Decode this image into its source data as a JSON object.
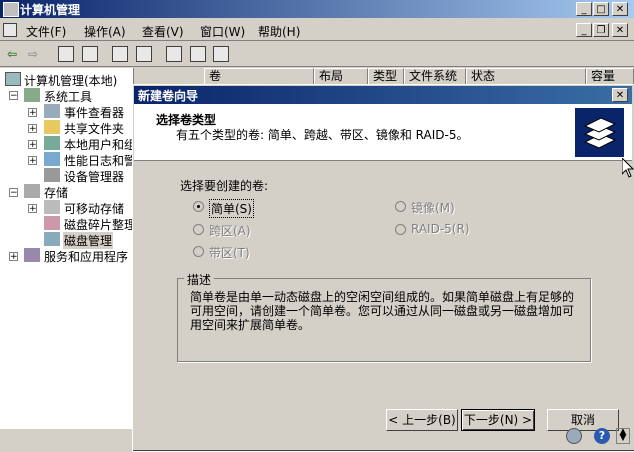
{
  "window": {
    "title": "计算机管理"
  },
  "menu": [
    "文件(F)",
    "操作(A)",
    "查看(V)",
    "窗口(W)",
    "帮助(H)"
  ],
  "tree": {
    "root": "计算机管理(本地)",
    "system_tools": "系统工具",
    "event_viewer": "事件查看器",
    "shared_folders": "共享文件夹",
    "local_users": "本地用户和组",
    "perf_logs": "性能日志和警报",
    "device_manager": "设备管理器",
    "storage": "存储",
    "removable_storage": "可移动存储",
    "defrag": "磁盘碎片整理程序",
    "disk_mgmt": "磁盘管理",
    "services_apps": "服务和应用程序"
  },
  "list_headers": [
    "卷",
    "布局",
    "类型",
    "文件系统",
    "状态",
    "容量"
  ],
  "wizard": {
    "title": "新建卷向导",
    "heading": "选择卷类型",
    "subheading": "有五个类型的卷: 简单、跨越、带区、镜像和 RAID-5。",
    "group_label": "选择要创建的卷:",
    "options": {
      "simple": "简单(S)",
      "spanned": "跨区(A)",
      "striped": "带区(T)",
      "mirror": "镜像(M)",
      "raid5": "RAID-5(R)"
    },
    "desc_label": "描述",
    "desc_text": "简单卷是由单一动态磁盘上的空闲空间组成的。如果简单磁盘上有足够的可用空间，请创建一个简单卷。您可以通过从同一磁盘或另一磁盘增加可用空间来扩展简单卷。",
    "back": "< 上一步(B)",
    "next": "下一步(N) >",
    "cancel": "取消"
  },
  "colors": {
    "titlebar": "#0a246a",
    "face": "#d4d0c8"
  }
}
